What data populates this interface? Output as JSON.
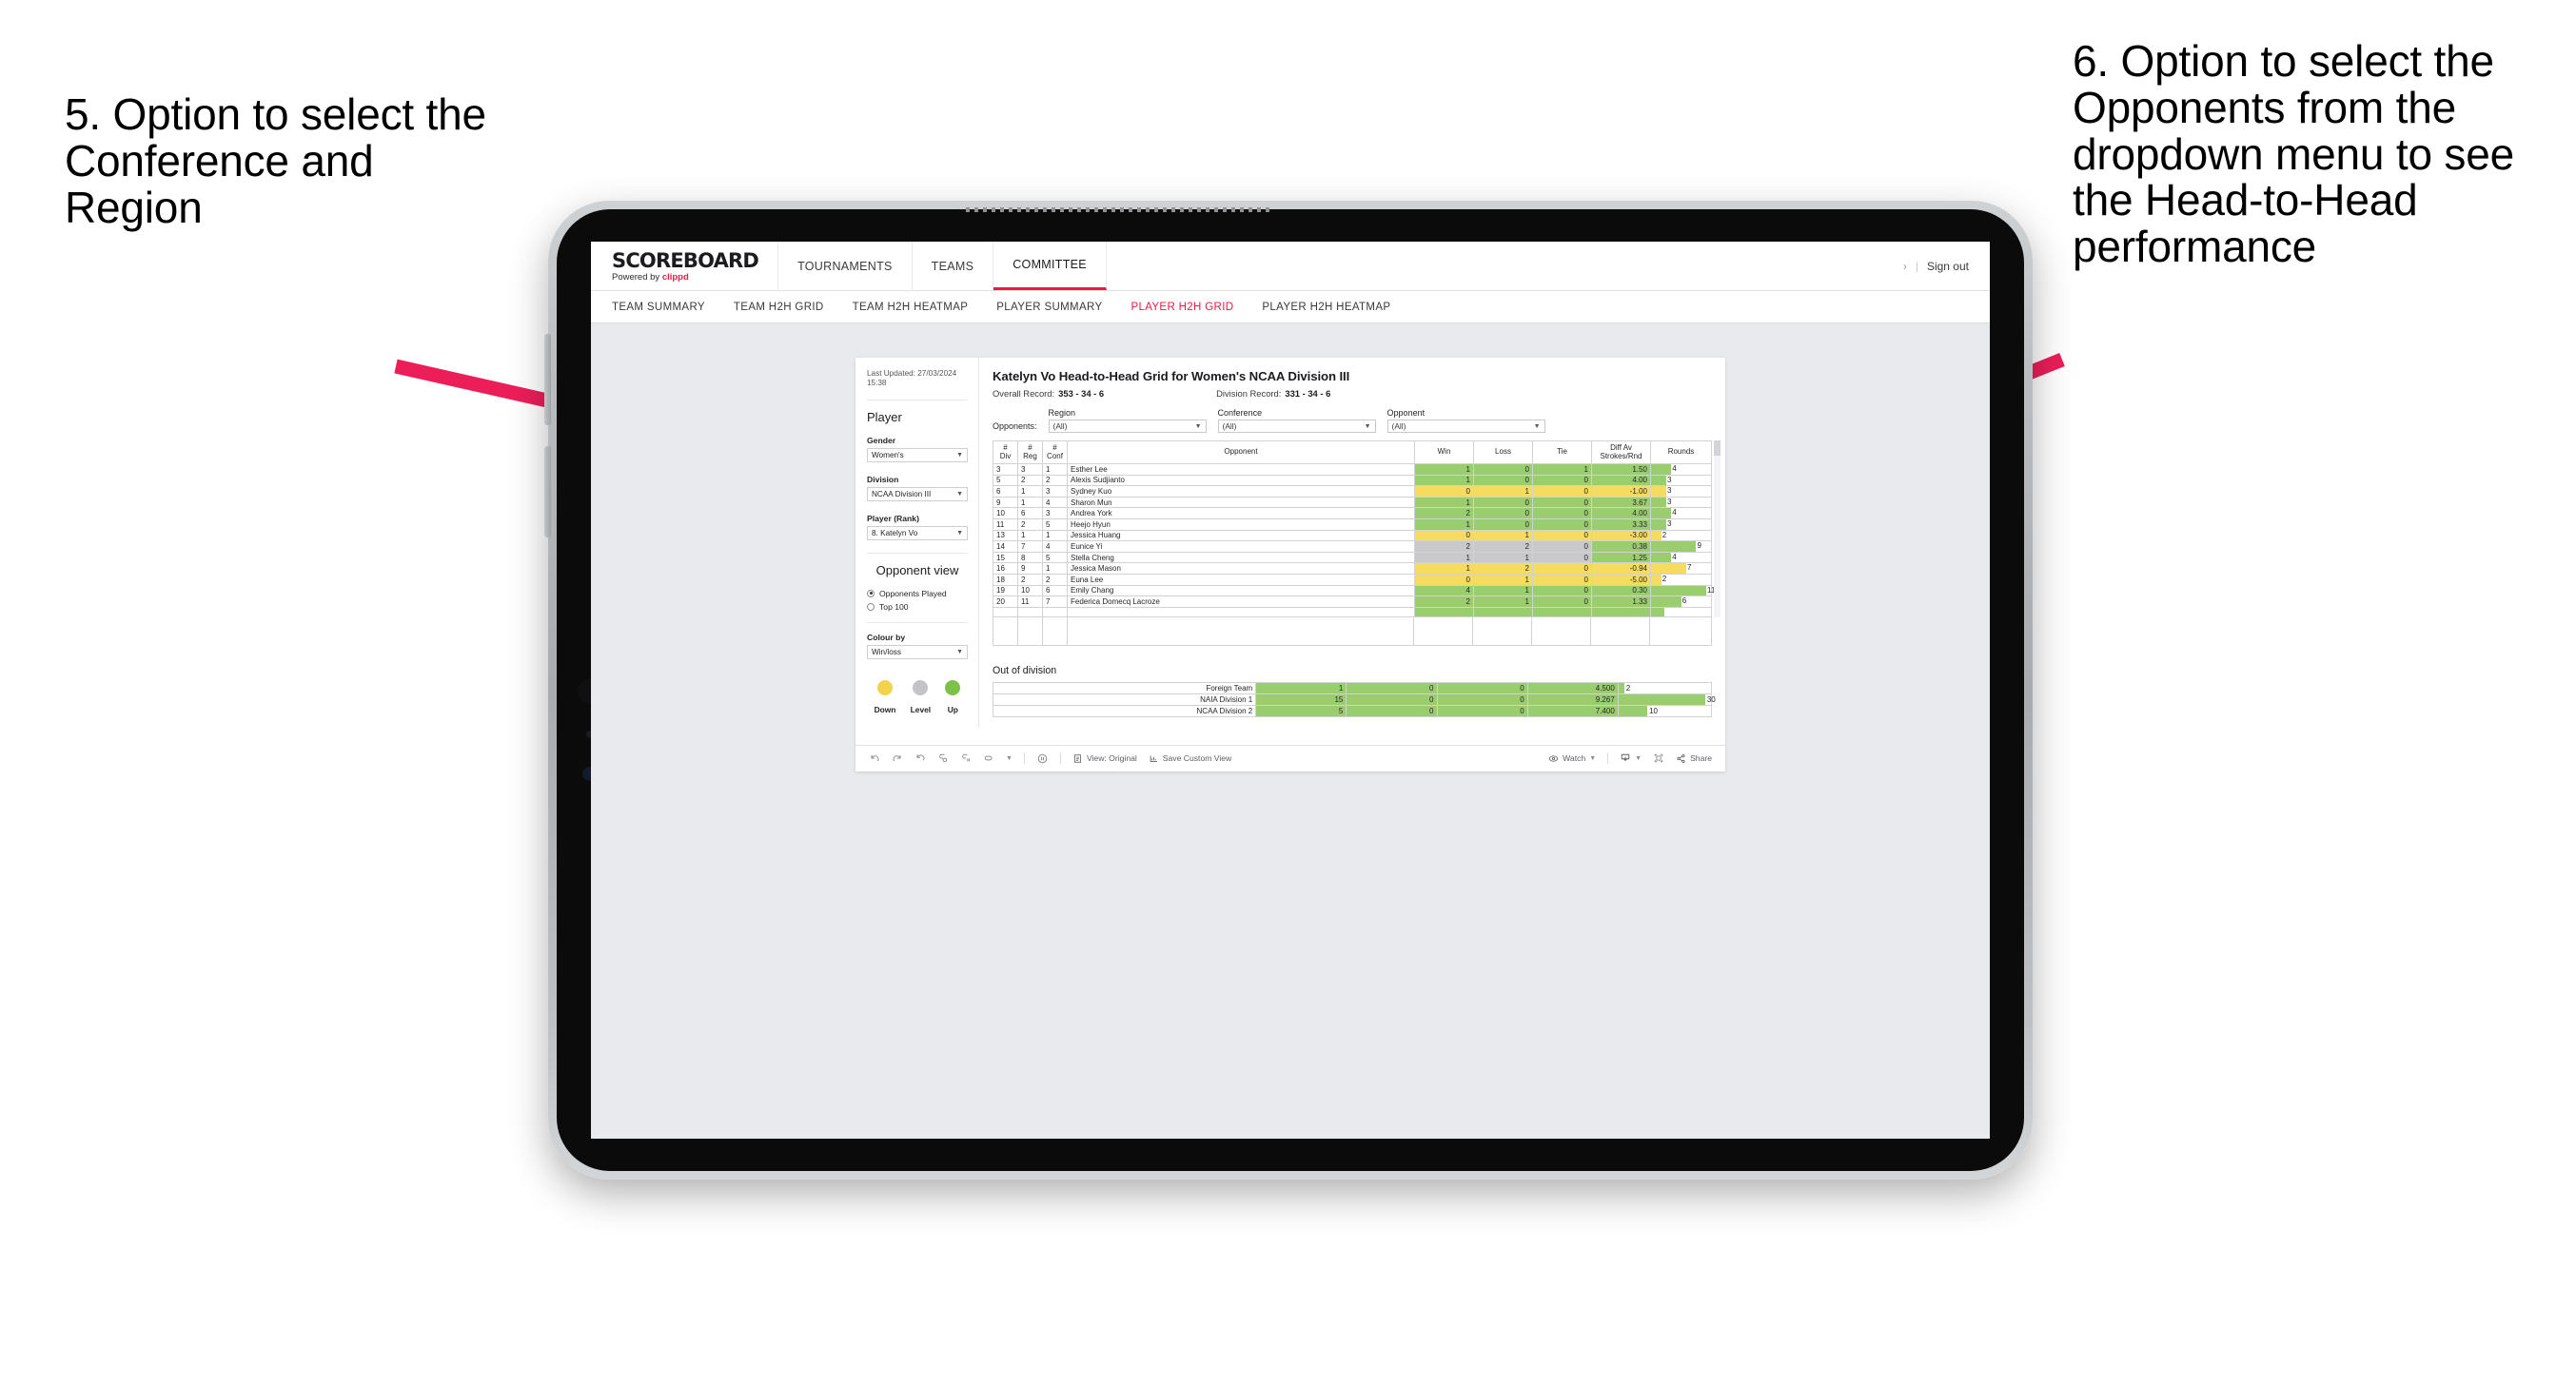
{
  "annotations": {
    "left": "5. Option to select the Conference and Region",
    "right": "6. Option to select the Opponents from the dropdown menu to see the Head-to-Head performance"
  },
  "colors": {
    "accent": "#ec1944",
    "arrow": "#ec1e5a",
    "up_green": "#9ACD6E",
    "down_yellow": "#F5DC5F",
    "level_gray": "#C9C9CC"
  },
  "header": {
    "brand_title": "SCOREBOARD",
    "brand_sub_prefix": "Powered by ",
    "brand_sub_accent": "clippd",
    "nav": [
      {
        "label": "TOURNAMENTS",
        "active": false
      },
      {
        "label": "TEAMS",
        "active": false
      },
      {
        "label": "COMMITTEE",
        "active": true
      }
    ],
    "chevron": "›",
    "divider": "|",
    "sign_out": "Sign out"
  },
  "subnav": [
    {
      "label": "TEAM SUMMARY",
      "active": false
    },
    {
      "label": "TEAM H2H GRID",
      "active": false
    },
    {
      "label": "TEAM H2H HEATMAP",
      "active": false
    },
    {
      "label": "PLAYER SUMMARY",
      "active": false
    },
    {
      "label": "PLAYER H2H GRID",
      "active": true
    },
    {
      "label": "PLAYER H2H HEATMAP",
      "active": false
    }
  ],
  "sidebar": {
    "last_updated": "Last Updated: 27/03/2024 15:38",
    "player_heading": "Player",
    "fields": [
      {
        "label": "Gender",
        "value": "Women's"
      },
      {
        "label": "Division",
        "value": "NCAA Division III"
      },
      {
        "label": "Player (Rank)",
        "value": "8. Katelyn Vo"
      }
    ],
    "opponent_view_heading": "Opponent view",
    "opponent_view_options": [
      {
        "label": "Opponents Played",
        "selected": true
      },
      {
        "label": "Top 100",
        "selected": false
      }
    ],
    "colour_by_label": "Colour by",
    "colour_by_value": "Win/loss",
    "legend": [
      {
        "caption": "Down",
        "color": "#F2D34B"
      },
      {
        "caption": "Level",
        "color": "#C4C4C8"
      },
      {
        "caption": "Up",
        "color": "#7CC24A"
      }
    ]
  },
  "main": {
    "title": "Katelyn Vo Head-to-Head Grid for Women's NCAA Division III",
    "overall_record_label": "Overall Record:",
    "overall_record_value": "353 - 34 - 6",
    "division_record_label": "Division Record:",
    "division_record_value": "331 - 34 - 6",
    "opponents_label": "Opponents:",
    "filters": [
      {
        "label": "Region",
        "value": "(All)"
      },
      {
        "label": "Conference",
        "value": "(All)"
      },
      {
        "label": "Opponent",
        "value": "(All)"
      }
    ]
  },
  "chart_data": {
    "type": "table",
    "title": "Katelyn Vo Head-to-Head Grid for Women's NCAA Division III",
    "columns": [
      "# Div",
      "# Reg",
      "# Conf",
      "Opponent",
      "Win",
      "Loss",
      "Tie",
      "Diff Av Strokes/Rnd",
      "Rounds"
    ],
    "column_headers_multiline": [
      [
        "#",
        "Div"
      ],
      [
        "#",
        "Reg"
      ],
      [
        "#",
        "Conf"
      ],
      [
        "Opponent"
      ],
      [
        "Win"
      ],
      [
        "Loss"
      ],
      [
        "Tie"
      ],
      [
        "Diff Av",
        "Strokes/Rnd"
      ],
      [
        "Rounds"
      ]
    ],
    "rounds_axis_max": 12,
    "rows": [
      {
        "div": "3",
        "reg": "3",
        "conf": "1",
        "opponent": "Esther Lee",
        "win": "1",
        "loss": "0",
        "tie": "1",
        "diff": "1.50",
        "rounds": 4,
        "state": "up"
      },
      {
        "div": "5",
        "reg": "2",
        "conf": "2",
        "opponent": "Alexis Sudjianto",
        "win": "1",
        "loss": "0",
        "tie": "0",
        "diff": "4.00",
        "rounds": 3,
        "state": "up"
      },
      {
        "div": "6",
        "reg": "1",
        "conf": "3",
        "opponent": "Sydney Kuo",
        "win": "0",
        "loss": "1",
        "tie": "0",
        "diff": "-1.00",
        "rounds": 3,
        "state": "down"
      },
      {
        "div": "9",
        "reg": "1",
        "conf": "4",
        "opponent": "Sharon Mun",
        "win": "1",
        "loss": "0",
        "tie": "0",
        "diff": "3.67",
        "rounds": 3,
        "state": "up"
      },
      {
        "div": "10",
        "reg": "6",
        "conf": "3",
        "opponent": "Andrea York",
        "win": "2",
        "loss": "0",
        "tie": "0",
        "diff": "4.00",
        "rounds": 4,
        "state": "up"
      },
      {
        "div": "11",
        "reg": "2",
        "conf": "5",
        "opponent": "Heejo Hyun",
        "win": "1",
        "loss": "0",
        "tie": "0",
        "diff": "3.33",
        "rounds": 3,
        "state": "up"
      },
      {
        "div": "13",
        "reg": "1",
        "conf": "1",
        "opponent": "Jessica Huang",
        "win": "0",
        "loss": "1",
        "tie": "0",
        "diff": "-3.00",
        "rounds": 2,
        "state": "down"
      },
      {
        "div": "14",
        "reg": "7",
        "conf": "4",
        "opponent": "Eunice Yi",
        "win": "2",
        "loss": "2",
        "tie": "0",
        "diff": "0.38",
        "rounds": 9,
        "state": "level",
        "diff_state": "up"
      },
      {
        "div": "15",
        "reg": "8",
        "conf": "5",
        "opponent": "Stella Cheng",
        "win": "1",
        "loss": "1",
        "tie": "0",
        "diff": "1.25",
        "rounds": 4,
        "state": "level",
        "diff_state": "up"
      },
      {
        "div": "16",
        "reg": "9",
        "conf": "1",
        "opponent": "Jessica Mason",
        "win": "1",
        "loss": "2",
        "tie": "0",
        "diff": "-0.94",
        "rounds": 7,
        "state": "down"
      },
      {
        "div": "18",
        "reg": "2",
        "conf": "2",
        "opponent": "Euna Lee",
        "win": "0",
        "loss": "1",
        "tie": "0",
        "diff": "-5.00",
        "rounds": 2,
        "state": "down"
      },
      {
        "div": "19",
        "reg": "10",
        "conf": "6",
        "opponent": "Emily Chang",
        "win": "4",
        "loss": "1",
        "tie": "0",
        "diff": "0.30",
        "rounds": 11,
        "state": "up"
      },
      {
        "div": "20",
        "reg": "11",
        "conf": "7",
        "opponent": "Federica Domecq Lacroze",
        "win": "2",
        "loss": "1",
        "tie": "0",
        "diff": "1.33",
        "rounds": 6,
        "state": "up"
      }
    ],
    "out_of_division": {
      "title": "Out of division",
      "rounds_axis_max": 32,
      "rows": [
        {
          "name": "Foreign Team",
          "win": "1",
          "loss": "0",
          "tie": "0",
          "diff": "4.500",
          "rounds": 2,
          "state": "up"
        },
        {
          "name": "NAIA Division 1",
          "win": "15",
          "loss": "0",
          "tie": "0",
          "diff": "9.267",
          "rounds": 30,
          "state": "up"
        },
        {
          "name": "NCAA Division 2",
          "win": "5",
          "loss": "0",
          "tie": "0",
          "diff": "7.400",
          "rounds": 10,
          "state": "up"
        }
      ]
    }
  },
  "toolbar": {
    "view_label": "View: Original",
    "save_label": "Save Custom View",
    "watch_label": "Watch",
    "share_label": "Share"
  }
}
